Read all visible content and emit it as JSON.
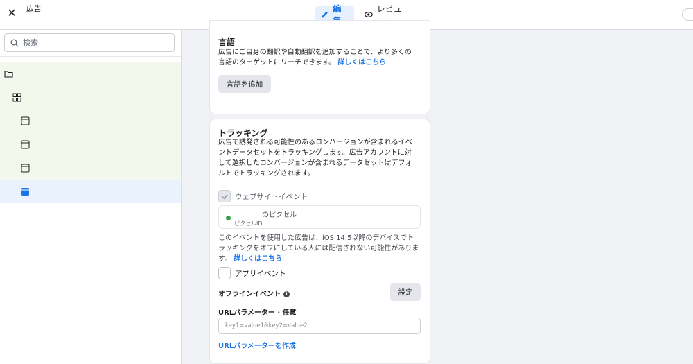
{
  "header": {
    "title": "広告",
    "tabs": [
      {
        "label": "編集",
        "icon": "pencil-icon",
        "active": true
      },
      {
        "label": "レビュー",
        "icon": "eye-icon",
        "active": false
      }
    ]
  },
  "sidebar": {
    "search_placeholder": "検索",
    "tree": [
      {
        "icon": "folder-icon",
        "selected": false
      },
      {
        "icon": "grid-icon",
        "selected": false
      },
      {
        "icon": "ad-icon",
        "selected": false
      },
      {
        "icon": "ad-icon",
        "selected": false
      },
      {
        "icon": "ad-icon",
        "selected": false
      },
      {
        "icon": "ad-icon",
        "selected": true
      }
    ]
  },
  "language": {
    "title": "言語",
    "description_lines": [
      "広告にご自身の翻訳や自動翻訳を追加することで、より多くの",
      "言語のターゲットにリーチできます。"
    ],
    "learn_more": "詳しくはこちら",
    "add_button": "言語を追加"
  },
  "tracking": {
    "title": "トラッキング",
    "description_lines": [
      "広告で誘発される可能性のあるコンバージョンが含まれるイベ",
      "ントデータセットをトラッキングします。広告アカウントに対",
      "して選択したコンバージョンが含まれるデータセットはデフォ",
      "ルトでトラッキングされます。"
    ],
    "website_events_label": "ウェブサイトイベント",
    "pixel_name": "のピクセル",
    "pixel_id_label": "ピクセルID:",
    "ios_note_lines": [
      "このイベントを使用した広告は、iOS 14.5以降のデバイスでト",
      "ラッキングをオフにしている人には配信されない可能性がありま",
      "す。"
    ],
    "ios_learn_more": "詳しくはこちら",
    "app_events_label": "アプリイベント",
    "offline_events_label": "オフラインイベント",
    "settings_button": "設定",
    "url_params_label": "URLパラメーター · 任意",
    "url_params_placeholder": "key1=value1&key2=value2",
    "create_url_params_link": "URLパラメーターを作成"
  },
  "colors": {
    "accent": "#1b74e4",
    "status_green": "#31a24c",
    "tree_highlight": "#f4f8ec"
  }
}
